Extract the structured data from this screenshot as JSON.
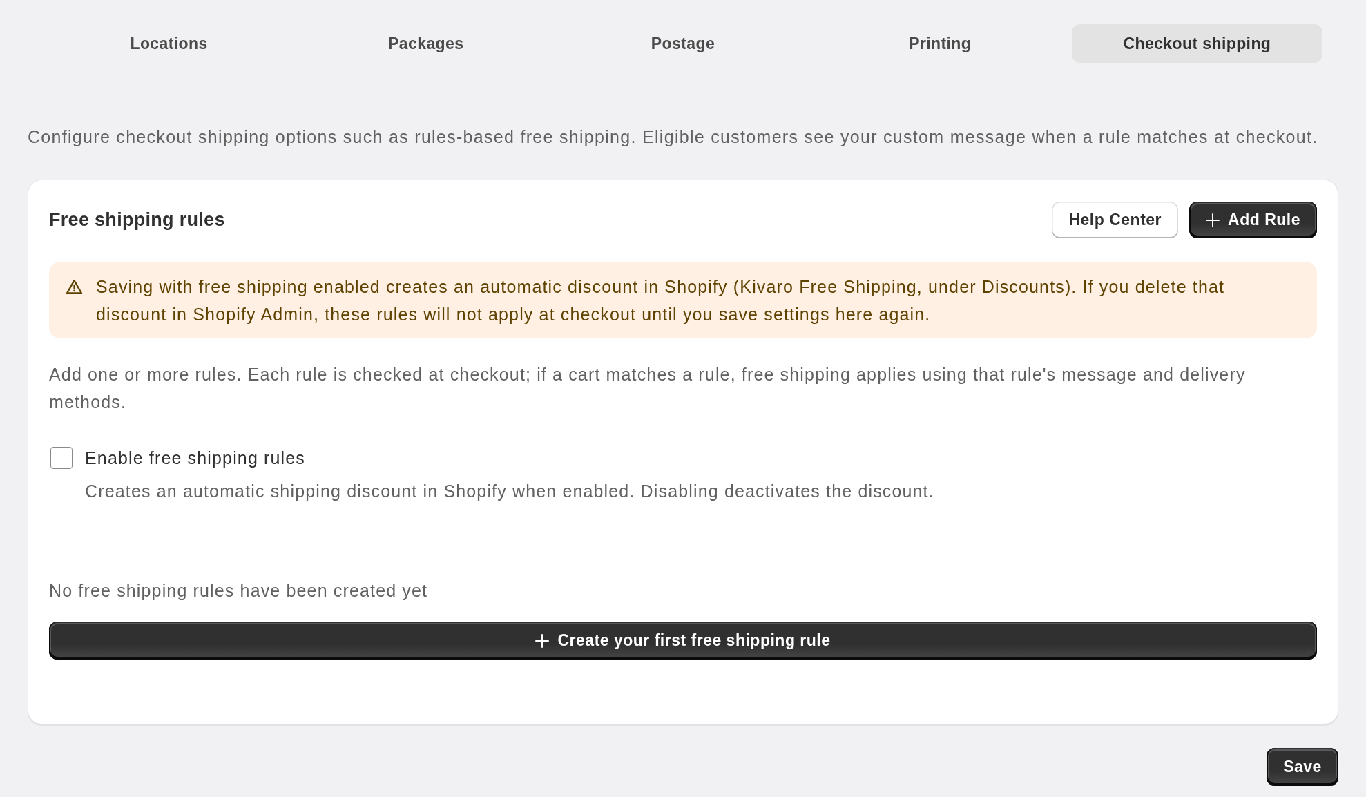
{
  "tabs": [
    {
      "label": "Locations",
      "selected": false
    },
    {
      "label": "Packages",
      "selected": false
    },
    {
      "label": "Postage",
      "selected": false
    },
    {
      "label": "Printing",
      "selected": false
    },
    {
      "label": "Checkout shipping",
      "selected": true
    }
  ],
  "description": "Configure checkout shipping options such as rules-based free shipping. Eligible customers see your custom message when a rule matches at checkout.",
  "card": {
    "title": "Free shipping rules",
    "buttons": [
      {
        "label": "Help Center",
        "kind": "secondary"
      },
      {
        "label": "Add Rule",
        "kind": "primary_add"
      }
    ],
    "banner": {
      "kind": "warning",
      "text": "Saving with free shipping enabled creates an automatic discount in Shopify (Kivaro Free Shipping, under Discounts). If you delete that discount in Shopify Admin, these rules will not apply at checkout until you save settings here again."
    },
    "intro": "Add one or more rules. Each rule is checked at checkout; if a cart matches a rule, free shipping applies using that rule's message and delivery methods.",
    "enable_checkbox": {
      "label": "Enable free shipping rules",
      "help": "Creates an automatic shipping discount in Shopify when enabled. Disabling deactivates the discount.",
      "checked": false
    },
    "empty_state": {
      "text": "No free shipping rules have been created yet",
      "button": {
        "label": "Create your first free shipping rule",
        "kind": "primary_add"
      }
    }
  },
  "footer": {
    "buttons": [
      {
        "label": "Save",
        "kind": "primary"
      }
    ]
  }
}
